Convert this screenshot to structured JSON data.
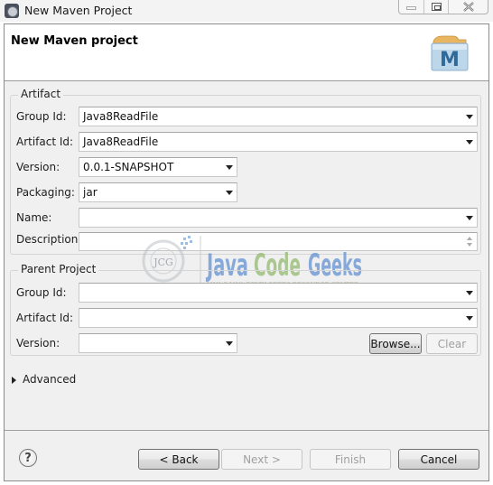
{
  "window": {
    "title": "New Maven Project",
    "controls": {
      "minimize": "minimize",
      "maximize": "maximize",
      "close": "close"
    }
  },
  "header": {
    "title": "New Maven project",
    "icon": "maven-folder-icon",
    "icon_letter": "M"
  },
  "artifact": {
    "group_label": "Artifact",
    "group_id": {
      "label": "Group Id:",
      "value": "Java8ReadFile"
    },
    "artifact_id": {
      "label": "Artifact Id:",
      "value": "Java8ReadFile"
    },
    "version": {
      "label": "Version:",
      "value": "0.0.1-SNAPSHOT"
    },
    "packaging": {
      "label": "Packaging:",
      "value": "jar"
    },
    "name": {
      "label": "Name:",
      "value": ""
    },
    "description": {
      "label": "Description:",
      "value": ""
    }
  },
  "parent": {
    "group_label": "Parent Project",
    "group_id": {
      "label": "Group Id:",
      "value": ""
    },
    "artifact_id": {
      "label": "Artifact Id:",
      "value": ""
    },
    "version": {
      "label": "Version:",
      "value": ""
    },
    "browse_label": "Browse...",
    "clear_label": "Clear"
  },
  "advanced": {
    "label": "Advanced",
    "expanded": false
  },
  "watermark": {
    "logo": "JCG",
    "word1": "Java",
    "word2": "Code",
    "word3": "Geeks",
    "tagline": "JAVA 2 JAVA DEVELOPERS RESOURCE CENTER"
  },
  "footer": {
    "help_glyph": "?",
    "back_label": "< Back",
    "next_label": "Next >",
    "finish_label": "Finish",
    "cancel_label": "Cancel"
  }
}
